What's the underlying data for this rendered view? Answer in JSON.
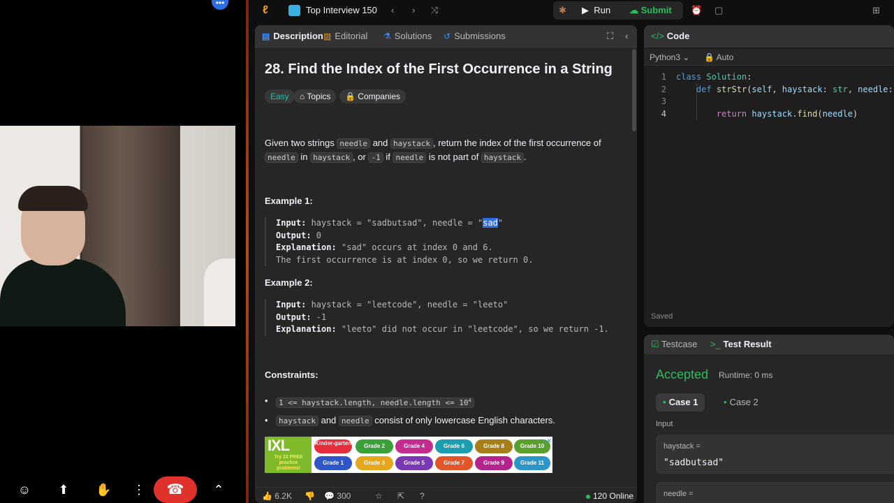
{
  "call": {
    "more_icon": "ellipsis-icon",
    "controls": [
      "emoji-icon",
      "share-screen-icon",
      "raise-hand-icon",
      "more-vertical-icon",
      "hang-up-icon",
      "chevron-up-icon"
    ]
  },
  "topbar": {
    "list_title": "Top Interview 150",
    "run_label": "Run",
    "submit_label": "Submit"
  },
  "left_tabs": [
    {
      "label": "Description",
      "icon": "description-icon",
      "active": true
    },
    {
      "label": "Editorial",
      "icon": "editorial-icon",
      "active": false
    },
    {
      "label": "Solutions",
      "icon": "solutions-icon",
      "active": false
    },
    {
      "label": "Submissions",
      "icon": "submissions-icon",
      "active": false
    }
  ],
  "problem": {
    "title": "28. Find the Index of the First Occurrence in a String",
    "difficulty": "Easy",
    "topics_label": "Topics",
    "companies_label": "Companies",
    "desc": {
      "t1": "Given two strings ",
      "c1": "needle",
      "t2": " and ",
      "c2": "haystack",
      "t3": ", return the index of the first occurrence of",
      "c3": "needle",
      "t4": " in ",
      "c4": "haystack",
      "t5": ", or ",
      "c5": "-1",
      "t6": " if ",
      "c6": "needle",
      "t7": " is not part of ",
      "c7": "haystack",
      "t8": "."
    },
    "example1": {
      "heading": "Example 1:",
      "input_label": "Input:",
      "input_pre": " haystack = \"sadbutsad\", needle = \"",
      "input_hl": "sad",
      "input_post": "\"",
      "output_label": "Output:",
      "output": " 0",
      "explanation_label": "Explanation:",
      "explanation": " \"sad\" occurs at index 0 and 6.",
      "explanation2": "The first occurrence is at index 0, so we return 0."
    },
    "example2": {
      "heading": "Example 2:",
      "input_label": "Input:",
      "input": " haystack = \"leetcode\", needle = \"leeto\"",
      "output_label": "Output:",
      "output": " -1",
      "explanation_label": "Explanation:",
      "explanation": " \"leeto\" did not occur in \"leetcode\", so we return -1."
    },
    "constraints_heading": "Constraints:",
    "constraint1_code": "1 <= haystack.length, needle.length <= 10",
    "constraint1_sup": "4",
    "constraint2_c1": "haystack",
    "constraint2_t1": " and ",
    "constraint2_c2": "needle",
    "constraint2_t2": " consist of only lowercase English characters."
  },
  "ad": {
    "logo": "IXL",
    "tagline": "Try 10 FREE practice problems!",
    "grades_top": [
      "Kinder-garten",
      "Grade 2",
      "Grade 4",
      "Grade 6",
      "Grade 8",
      "Grade 10"
    ],
    "grades_bottom": [
      "Grade 1",
      "Grade 3",
      "Grade 5",
      "Grade 7",
      "Grade 9",
      "Grade 11"
    ]
  },
  "footer": {
    "likes": "6.2K",
    "comments": "300",
    "online": "120 Online"
  },
  "code_panel": {
    "title": "Code",
    "language": "Python3",
    "mode": "Auto",
    "lines": [
      "1",
      "2",
      "3",
      "4"
    ],
    "saved": "Saved"
  },
  "test_panel": {
    "tab_testcase": "Testcase",
    "tab_result": "Test Result",
    "status": "Accepted",
    "runtime": "Runtime: 0 ms",
    "case1": "Case 1",
    "case2": "Case 2",
    "input_label": "Input",
    "param1_name": "haystack =",
    "param1_value": "\"sadbutsad\"",
    "param2_name": "needle ="
  },
  "colors": {
    "accent_green": "#2cbb5d",
    "easy": "#2cbbad",
    "hangup_red": "#e0312b",
    "selection_blue": "#2f6fe4"
  }
}
